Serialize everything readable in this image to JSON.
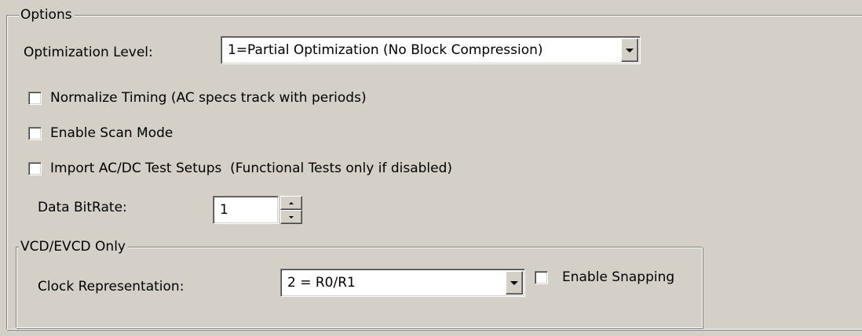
{
  "options": {
    "legend": "Options",
    "optimization_level": {
      "label": "Optimization Level:",
      "value": "1=Partial Optimization (No Block Compression)"
    },
    "checkboxes": [
      {
        "label": "Normalize Timing (AC specs track with periods)",
        "checked": false
      },
      {
        "label": "Enable Scan Mode",
        "checked": false
      },
      {
        "label": "Import AC/DC Test Setups  (Functional Tests only if disabled)",
        "checked": false
      }
    ],
    "data_bitrate": {
      "label": "Data BitRate:",
      "value": "1"
    }
  },
  "vcd": {
    "legend": "VCD/EVCD Only",
    "clock_representation": {
      "label": "Clock Representation:",
      "value": "2 = R0/R1"
    },
    "enable_snapping": {
      "label": "Enable Snapping",
      "checked": false
    }
  }
}
